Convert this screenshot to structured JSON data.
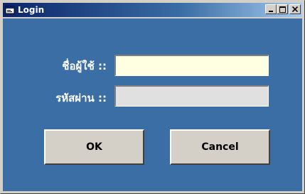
{
  "window": {
    "title": "Login",
    "controls": {
      "minimize_icon": "minimize-icon",
      "maximize_icon": "maximize-icon",
      "close_icon": "close-icon"
    }
  },
  "form": {
    "username_label": "ชื่อผู้ใช้ ::",
    "username_value": "",
    "password_label": "รหัสผ่าน ::",
    "password_value": ""
  },
  "buttons": {
    "ok_label": "OK",
    "cancel_label": "Cancel"
  },
  "colors": {
    "client_background": "#3a6ea5",
    "username_field_background": "#ffffe1",
    "password_field_background": "#e0e0e0",
    "button_face": "#d4d0c8"
  }
}
